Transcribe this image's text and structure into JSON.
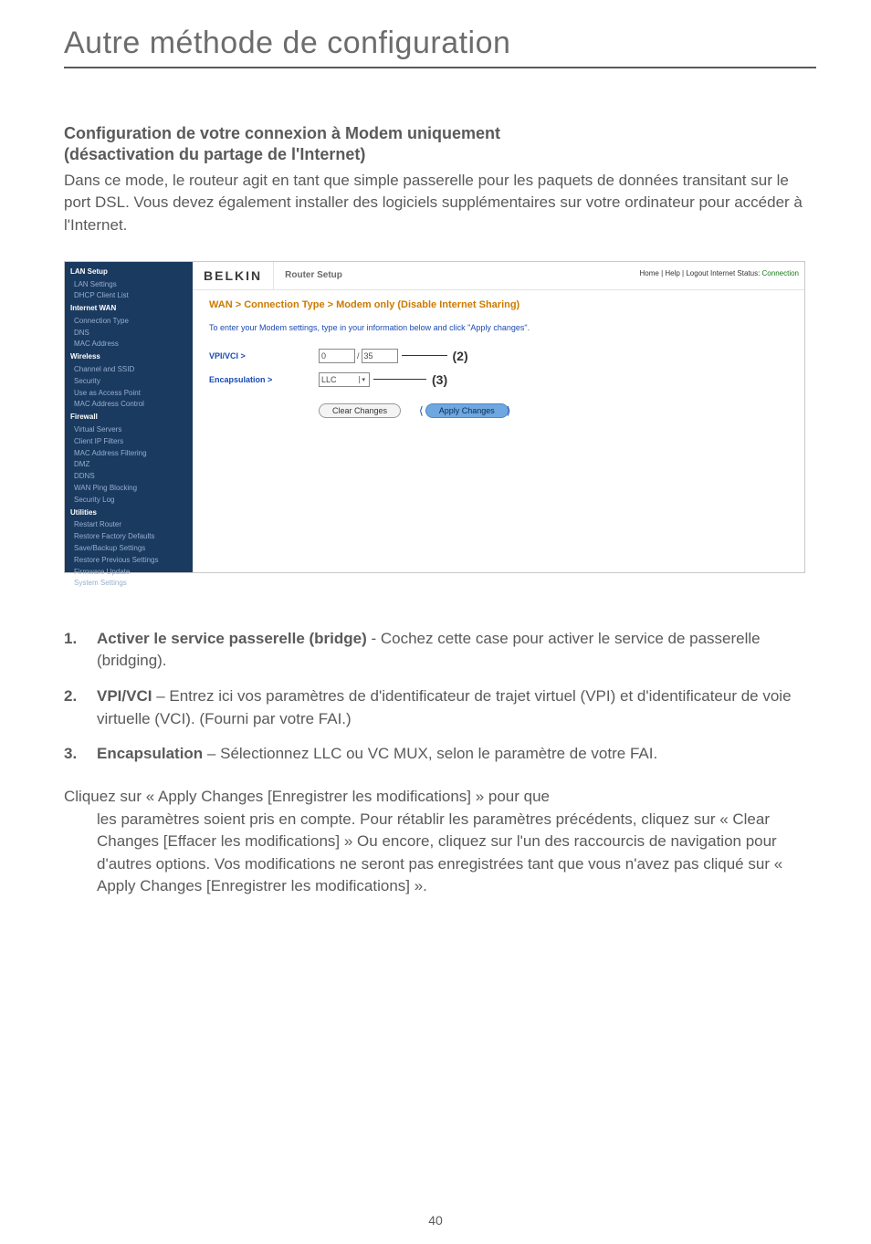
{
  "page": {
    "title": "Autre méthode de configuration",
    "section_heading_line1": "Configuration de votre connexion à Modem uniquement",
    "section_heading_line2": "(désactivation du partage de l'Internet)",
    "intro": "Dans ce mode, le routeur agit en tant que simple passerelle pour les paquets de données transitant sur le port DSL. Vous devez également installer des logiciels supplémentaires sur votre ordinateur pour accéder à l'Internet.",
    "page_number": "40"
  },
  "shot": {
    "brand": "BELKIN",
    "toolbar_title": "Router Setup",
    "toolbar_right_prefix": "Home | Help | Logout   Internet Status: ",
    "toolbar_right_status": "Connection",
    "sidebar": {
      "groups": [
        {
          "head": "LAN Setup",
          "items": [
            "LAN Settings",
            "DHCP Client List"
          ]
        },
        {
          "head": "Internet WAN",
          "items": [
            "Connection Type",
            "DNS",
            "MAC Address"
          ]
        },
        {
          "head": "Wireless",
          "items": [
            "Channel and SSID",
            "Security",
            "Use as Access Point",
            "MAC Address Control"
          ]
        },
        {
          "head": "Firewall",
          "items": [
            "Virtual Servers",
            "Client IP Filters",
            "MAC Address Filtering",
            "DMZ",
            "DDNS",
            "WAN Ping Blocking",
            "Security Log"
          ]
        },
        {
          "head": "Utilities",
          "items": [
            "Restart Router",
            "Restore Factory Defaults",
            "Save/Backup Settings",
            "Restore Previous Settings",
            "Firmware Update",
            "System Settings"
          ]
        }
      ]
    },
    "content": {
      "title": "WAN > Connection Type > Modem only (Disable Internet Sharing)",
      "hint": "To enter your Modem settings, type in your information below and click \"Apply changes\".",
      "row_vpivci_label": "VPI/VCI >",
      "row_vpivci_val1": "0",
      "row_vpivci_val2": "35",
      "annot2": "(2)",
      "row_encap_label": "Encapsulation >",
      "row_encap_val": "LLC",
      "annot3": "(3)",
      "btn_clear": "Clear Changes",
      "btn_apply": "Apply Changes"
    }
  },
  "list": {
    "items": [
      {
        "num": "1.",
        "lead": "Activer le service passerelle (bridge)",
        "rest": " -  Cochez cette case pour activer le service de passerelle (bridging)."
      },
      {
        "num": "2.",
        "lead": "VPI/VCI",
        "rest": " – Entrez ici vos paramètres de d'identificateur de trajet virtuel (VPI) et d'identificateur de voie virtuelle (VCI). (Fourni par votre FAI.)"
      },
      {
        "num": "3.",
        "lead": "Encapsulation ",
        "rest": " – Sélectionnez LLC ou VC MUX, selon le paramètre de votre FAI."
      }
    ]
  },
  "closing": {
    "first": "Cliquez sur « Apply Changes [Enregistrer les modifications] » pour que",
    "rest": "les paramètres soient pris en compte. Pour rétablir les paramètres précédents, cliquez sur « Clear Changes [Effacer les modifications] » Ou encore, cliquez sur l'un des raccourcis de navigation pour d'autres options. Vos modifications ne seront pas enregistrées tant que vous n'avez pas cliqué sur « Apply Changes [Enregistrer les modifications] »."
  }
}
